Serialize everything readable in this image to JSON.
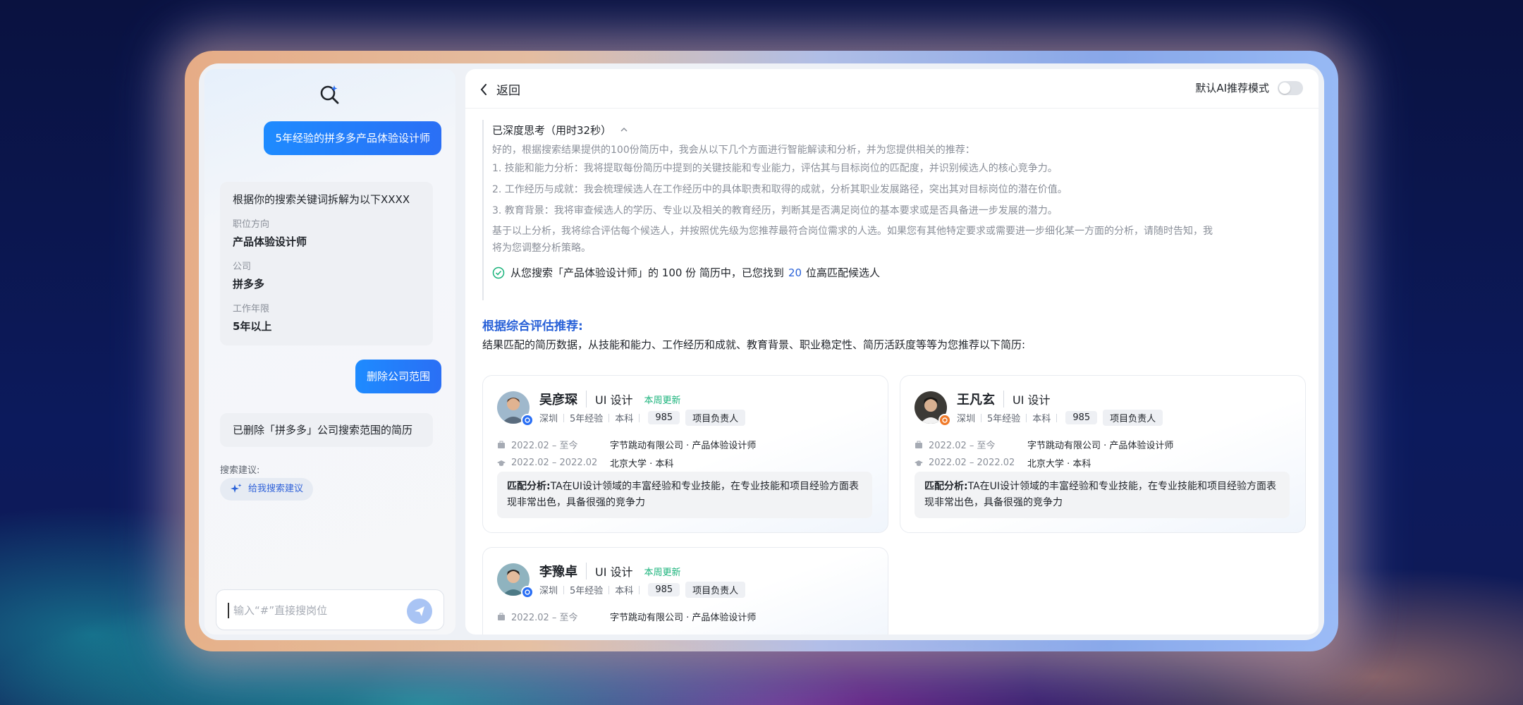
{
  "colors": {
    "accent": "#2a62d8",
    "user_bubble": "#1e8bff",
    "update_green": "#1ab37b"
  },
  "left": {
    "logo_icon": "search-sparkle-icon",
    "user_query": "5年经验的拼多多产品体验设计师",
    "keywords_card": {
      "title": "根据你的搜索关键词拆解为以下XXXX",
      "fields": [
        {
          "label": "职位方向",
          "value": "产品体验设计师"
        },
        {
          "label": "公司",
          "value": "拼多多"
        },
        {
          "label": "工作年限",
          "value": "5年以上"
        }
      ]
    },
    "user_action": "删除公司范围",
    "reply": "已删除「拼多多」公司搜索范围的简历",
    "suggest_label": "搜索建议:",
    "suggest_chip": "给我搜索建议",
    "input_placeholder": "输入“#”直接搜岗位"
  },
  "right": {
    "back_label": "返回",
    "ai_mode_label": "默认AI推荐模式",
    "ai_mode_on": false,
    "think": {
      "header": "已深度思考（用时32秒）",
      "lines": [
        "好的，根据搜索结果提供的100份简历中，我会从以下几个方面进行智能解读和分析，并为您提供相关的推荐：",
        "1. 技能和能力分析：我将提取每份简历中提到的关键技能和专业能力，评估其与目标岗位的匹配度，并识别候选人的核心竞争力。",
        "2. 工作经历与成就：我会梳理候选人在工作经历中的具体职责和取得的成就，分析其职业发展路径，突出其对目标岗位的潜在价值。",
        "3. 教育背景：我将审查候选人的学历、专业以及相关的教育经历，判断其是否满足岗位的基本要求或是否具备进一步发展的潜力。",
        "基于以上分析，我将综合评估每个候选人，并按照优先级为您推荐最符合岗位需求的人选。如果您有其他特定要求或需要进一步细化某一方面的分析，请随时告知，我",
        "将为您调整分析策略。"
      ],
      "result_prefix": "从您搜索「产品体验设计师」的 100 份 简历中，已您找到",
      "result_count": "20",
      "result_suffix": "位高匹配候选人"
    },
    "rec_title": "根据综合评估推荐:",
    "rec_sub": "结果匹配的简历数据，从技能和能力、工作经历和成就、教育背景、职业稳定性、简历活跃度等等为您推荐以下简历:",
    "candidates": [
      {
        "name": "吴彦琛",
        "role": "UI 设计",
        "update": "本周更新",
        "city": "深圳",
        "exp": "5年经验",
        "degree": "本科",
        "chips": [
          "985",
          "项目负责人"
        ],
        "work_date": "2022.02 – 至今",
        "work_org": "字节跳动有限公司 · 产品体验设计师",
        "edu_date": "2022.02 – 2022.02",
        "edu_org": "北京大学 · 本科",
        "analysis_label": "匹配分析:",
        "analysis": "TA在UI设计领域的丰富经验和专业技能，在专业技能和项目经验方面表现非常出色，具备很强的竞争力"
      },
      {
        "name": "王凡玄",
        "role": "UI 设计",
        "update": "",
        "city": "深圳",
        "exp": "5年经验",
        "degree": "本科",
        "chips": [
          "985",
          "项目负责人"
        ],
        "work_date": "2022.02 – 至今",
        "work_org": "字节跳动有限公司 · 产品体验设计师",
        "edu_date": "2022.02 – 2022.02",
        "edu_org": "北京大学 · 本科",
        "analysis_label": "匹配分析:",
        "analysis": "TA在UI设计领域的丰富经验和专业技能，在专业技能和项目经验方面表现非常出色，具备很强的竞争力"
      },
      {
        "name": "李豫卓",
        "role": "UI 设计",
        "update": "本周更新",
        "city": "深圳",
        "exp": "5年经验",
        "degree": "本科",
        "chips": [
          "985",
          "项目负责人"
        ],
        "work_date": "2022.02 – 至今",
        "work_org": "字节跳动有限公司 · 产品体验设计师"
      }
    ]
  }
}
